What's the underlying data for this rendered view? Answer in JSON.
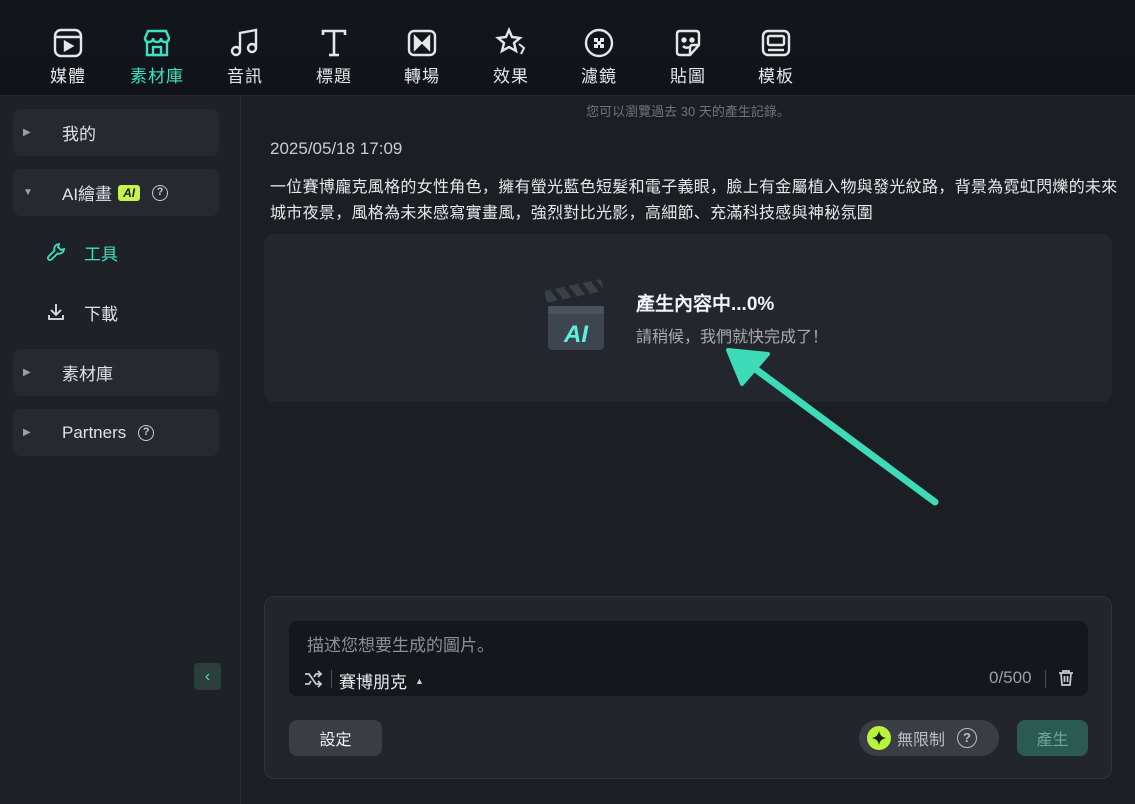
{
  "toolbar": {
    "items": [
      {
        "label": "媒體",
        "icon": "media-icon"
      },
      {
        "label": "素材庫",
        "icon": "store-icon"
      },
      {
        "label": "音訊",
        "icon": "music-note-icon"
      },
      {
        "label": "標題",
        "icon": "text-t-icon"
      },
      {
        "label": "轉場",
        "icon": "transition-icon"
      },
      {
        "label": "效果",
        "icon": "effects-star-icon"
      },
      {
        "label": "濾鏡",
        "icon": "filter-icon"
      },
      {
        "label": "貼圖",
        "icon": "sticker-icon"
      },
      {
        "label": "模板",
        "icon": "template-icon"
      }
    ],
    "active_index": 1
  },
  "sidebar": {
    "my": "我的",
    "ai_paint": "AI繪畫",
    "ai_badge": "AI",
    "tools": "工具",
    "download": "下載",
    "library": "素材庫",
    "partners": "Partners",
    "help_glyph": "?",
    "collapse_glyph": "‹"
  },
  "main": {
    "history_hint": "您可以瀏覽過去 30 天的產生記錄。",
    "timestamp": "2025/05/18 17:09",
    "prompt": "一位賽博龐克風格的女性角色，擁有螢光藍色短髮和電子義眼，臉上有金屬植入物與發光紋路，背景為霓虹閃爍的未來城市夜景，風格為未來感寫實畫風，強烈對比光影，高細節、充滿科技感與神秘氛圍",
    "generating_title": "產生內容中...0%",
    "generating_sub": "請稍候，我們就快完成了！",
    "progress_percent": 0,
    "clapper_text": "AI"
  },
  "input": {
    "placeholder": "描述您想要生成的圖片。",
    "style": "賽博朋克",
    "counter": "0/500",
    "settings_label": "設定",
    "unlimited_label": "無限制",
    "generate_label": "產生"
  },
  "colors": {
    "accent": "#3fe0c1",
    "badge": "#c8f24e",
    "generate_disabled": "#2b5a50"
  }
}
